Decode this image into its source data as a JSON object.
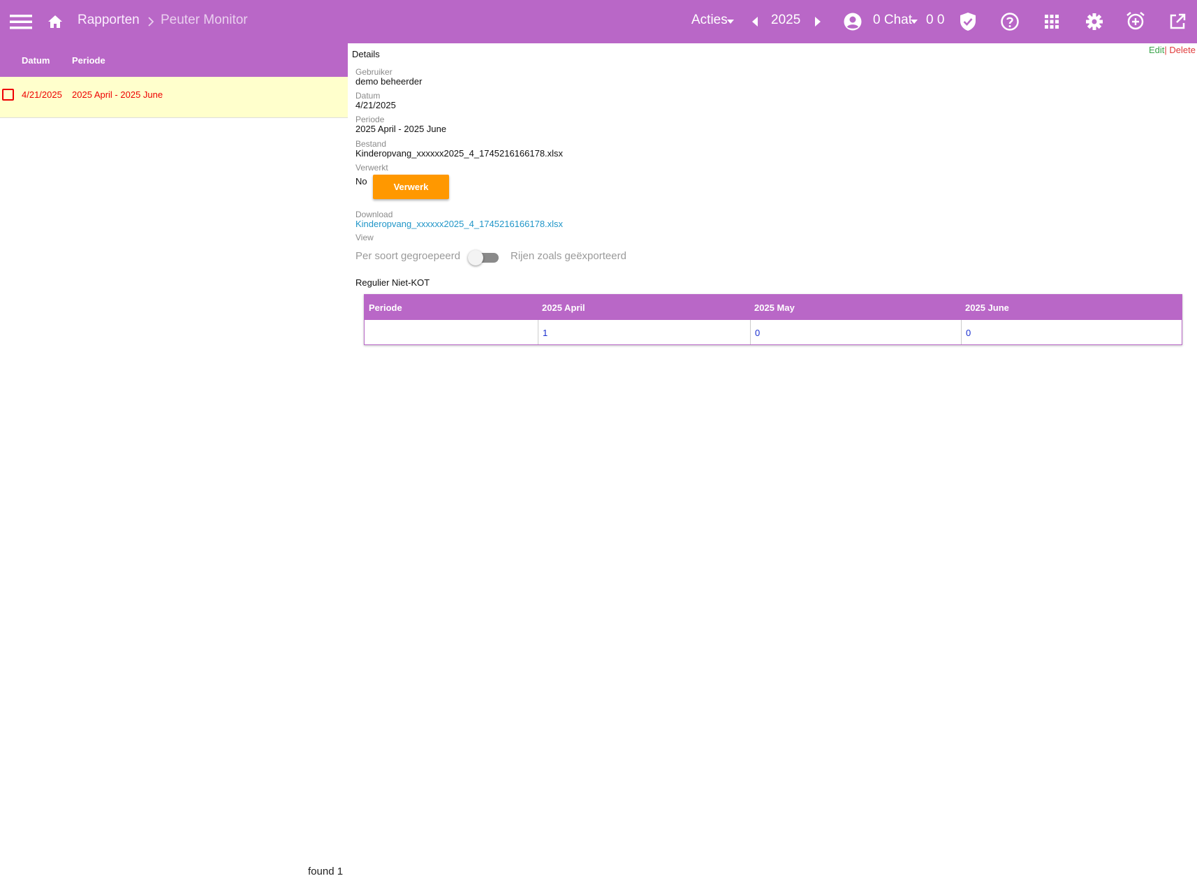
{
  "header": {
    "breadcrumb_root": "Rapporten",
    "breadcrumb_current": "Peuter Monitor",
    "acties_label": "Acties",
    "year": "2025",
    "chat_label": "0 Chat",
    "counters": "0 0",
    "colors": {
      "bar": "#b967c7"
    }
  },
  "list": {
    "columns": [
      "Datum",
      "Periode"
    ],
    "rows": [
      {
        "datum": "4/21/2025",
        "periode": "2025 April - 2025 June"
      }
    ],
    "found_text": "found 1"
  },
  "details": {
    "title": "Details",
    "edit_label": "Edit",
    "separator": "|",
    "delete_label": "Delete",
    "fields": {
      "gebruiker_label": "Gebruiker",
      "gebruiker_value": "demo beheerder",
      "datum_label": "Datum",
      "datum_value": "4/21/2025",
      "periode_label": "Periode",
      "periode_value": "2025 April - 2025 June",
      "bestand_label": "Bestand",
      "bestand_value": "Kinderopvang_xxxxxx2025_4_1745216166178.xlsx",
      "verwerkt_label": "Verwerkt",
      "verwerkt_value": "No",
      "download_label": "Download",
      "download_value": "Kinderopvang_xxxxxx2025_4_1745216166178.xlsx",
      "view_label": "View"
    },
    "verwerk_button": "Verwerk",
    "toggle": {
      "left_label": "Per soort gegroepeerd",
      "right_label": "Rijen zoals geëxporteerd",
      "on": false
    },
    "section_title": "Regulier Niet-KOT",
    "table": {
      "headers": [
        "Periode",
        "2025 April",
        "2025 May",
        "2025 June"
      ],
      "rows": [
        [
          "",
          "1",
          "0",
          "0"
        ]
      ]
    }
  }
}
